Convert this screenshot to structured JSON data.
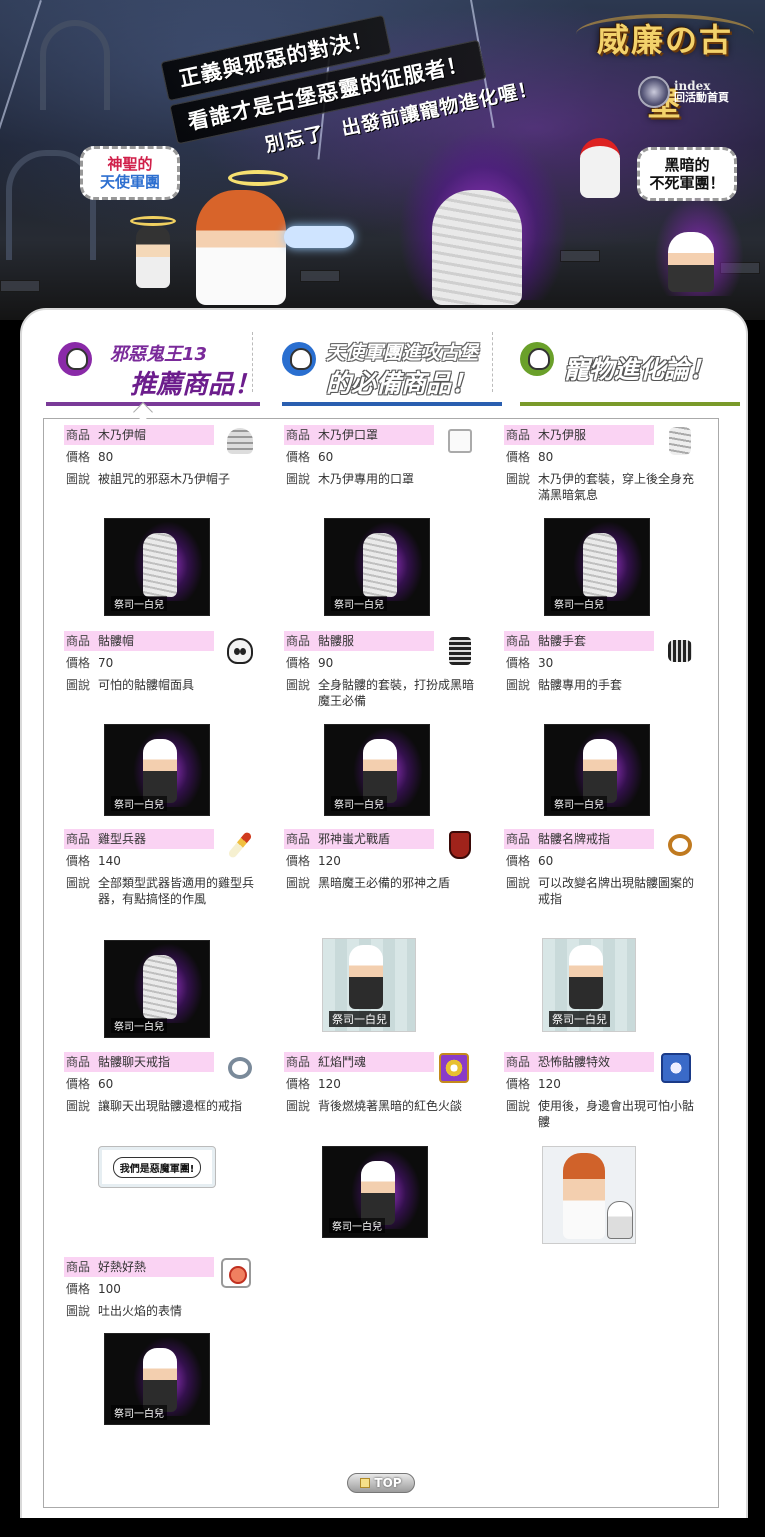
{
  "banner": {
    "slogans": [
      "正義與邪惡的對決！",
      "看誰才是古堡惡靈的征服者！",
      "別忘了",
      "出發前讓寵物進化喔！"
    ],
    "logo": "威廉の古堡",
    "index_en": "index",
    "index_zh": "回活動首頁",
    "angel_team": [
      "神聖的",
      "天使軍團"
    ],
    "dark_team": [
      "黑暗的",
      "不死軍團！"
    ]
  },
  "tabs": [
    {
      "line1": "邪惡鬼王13",
      "line2": "推薦商品！",
      "color": "#7a2a9a",
      "active": true
    },
    {
      "line1": "天使軍團進攻古堡",
      "line2": "的必備商品！",
      "color": "#2a5fb0",
      "active": false
    },
    {
      "line1": "寵物進化論！",
      "line2": "",
      "color": "#7a9a2a",
      "active": false
    }
  ],
  "labels": {
    "name": "商品",
    "price": "價格",
    "desc": "圖說",
    "shot_tag": "祭司一白兒"
  },
  "items": [
    {
      "name": "木乃伊帽",
      "price": "80",
      "desc": "被詛咒的邪惡木乃伊帽子",
      "icon": "mummy-hat-icon",
      "shot": "mummy"
    },
    {
      "name": "木乃伊口罩",
      "price": "60",
      "desc": "木乃伊專用的口罩",
      "icon": "mummy-mask-icon",
      "shot": "mummy"
    },
    {
      "name": "木乃伊服",
      "price": "80",
      "desc": "木乃伊的套裝，穿上後全身充滿黑暗氣息",
      "icon": "mummy-suit-icon",
      "shot": "mummy"
    },
    {
      "name": "骷髏帽",
      "price": "70",
      "desc": "可怕的骷髏帽面具",
      "icon": "skull-hat-icon",
      "shot": "skeleton"
    },
    {
      "name": "骷髏服",
      "price": "90",
      "desc": "全身骷髏的套裝，打扮成黑暗魔王必備",
      "icon": "skeleton-suit-icon",
      "shot": "skeleton"
    },
    {
      "name": "骷髏手套",
      "price": "30",
      "desc": "骷髏專用的手套",
      "icon": "skeleton-glove-icon",
      "shot": "skeleton"
    },
    {
      "name": "雞型兵器",
      "price": "140",
      "desc": "全部類型武器皆適用的雞型兵器，有點搞怪的作風",
      "icon": "chicken-weapon-icon",
      "shot": "mummy"
    },
    {
      "name": "邪神蚩尤戰盾",
      "price": "120",
      "desc": "黑暗魔王必備的邪神之盾",
      "icon": "shield-icon",
      "shot": "light"
    },
    {
      "name": "骷髏名牌戒指",
      "price": "60",
      "desc": "可以改變名牌出現骷髏圖案的戒指",
      "icon": "name-ring-icon",
      "shot": "light"
    },
    {
      "name": "骷髏聊天戒指",
      "price": "60",
      "desc": "讓聊天出現骷髏邊框的戒指",
      "icon": "chat-ring-icon",
      "shot": "chat",
      "chat_text": "我們是惡魔軍團!"
    },
    {
      "name": "紅焰鬥魂",
      "price": "120",
      "desc": "背後燃燒著黑暗的紅色火燄",
      "icon": "flame-aura-icon",
      "shot": "skeleton"
    },
    {
      "name": "恐怖骷髏特效",
      "price": "120",
      "desc": "使用後，身邊會出現可怕小骷髏",
      "icon": "skull-effect-icon",
      "shot": "girl"
    },
    {
      "name": "好熱好熱",
      "price": "100",
      "desc": "吐出火焰的表情",
      "icon": "hot-face-icon",
      "shot": "skeleton"
    }
  ],
  "top_button": "TOP"
}
